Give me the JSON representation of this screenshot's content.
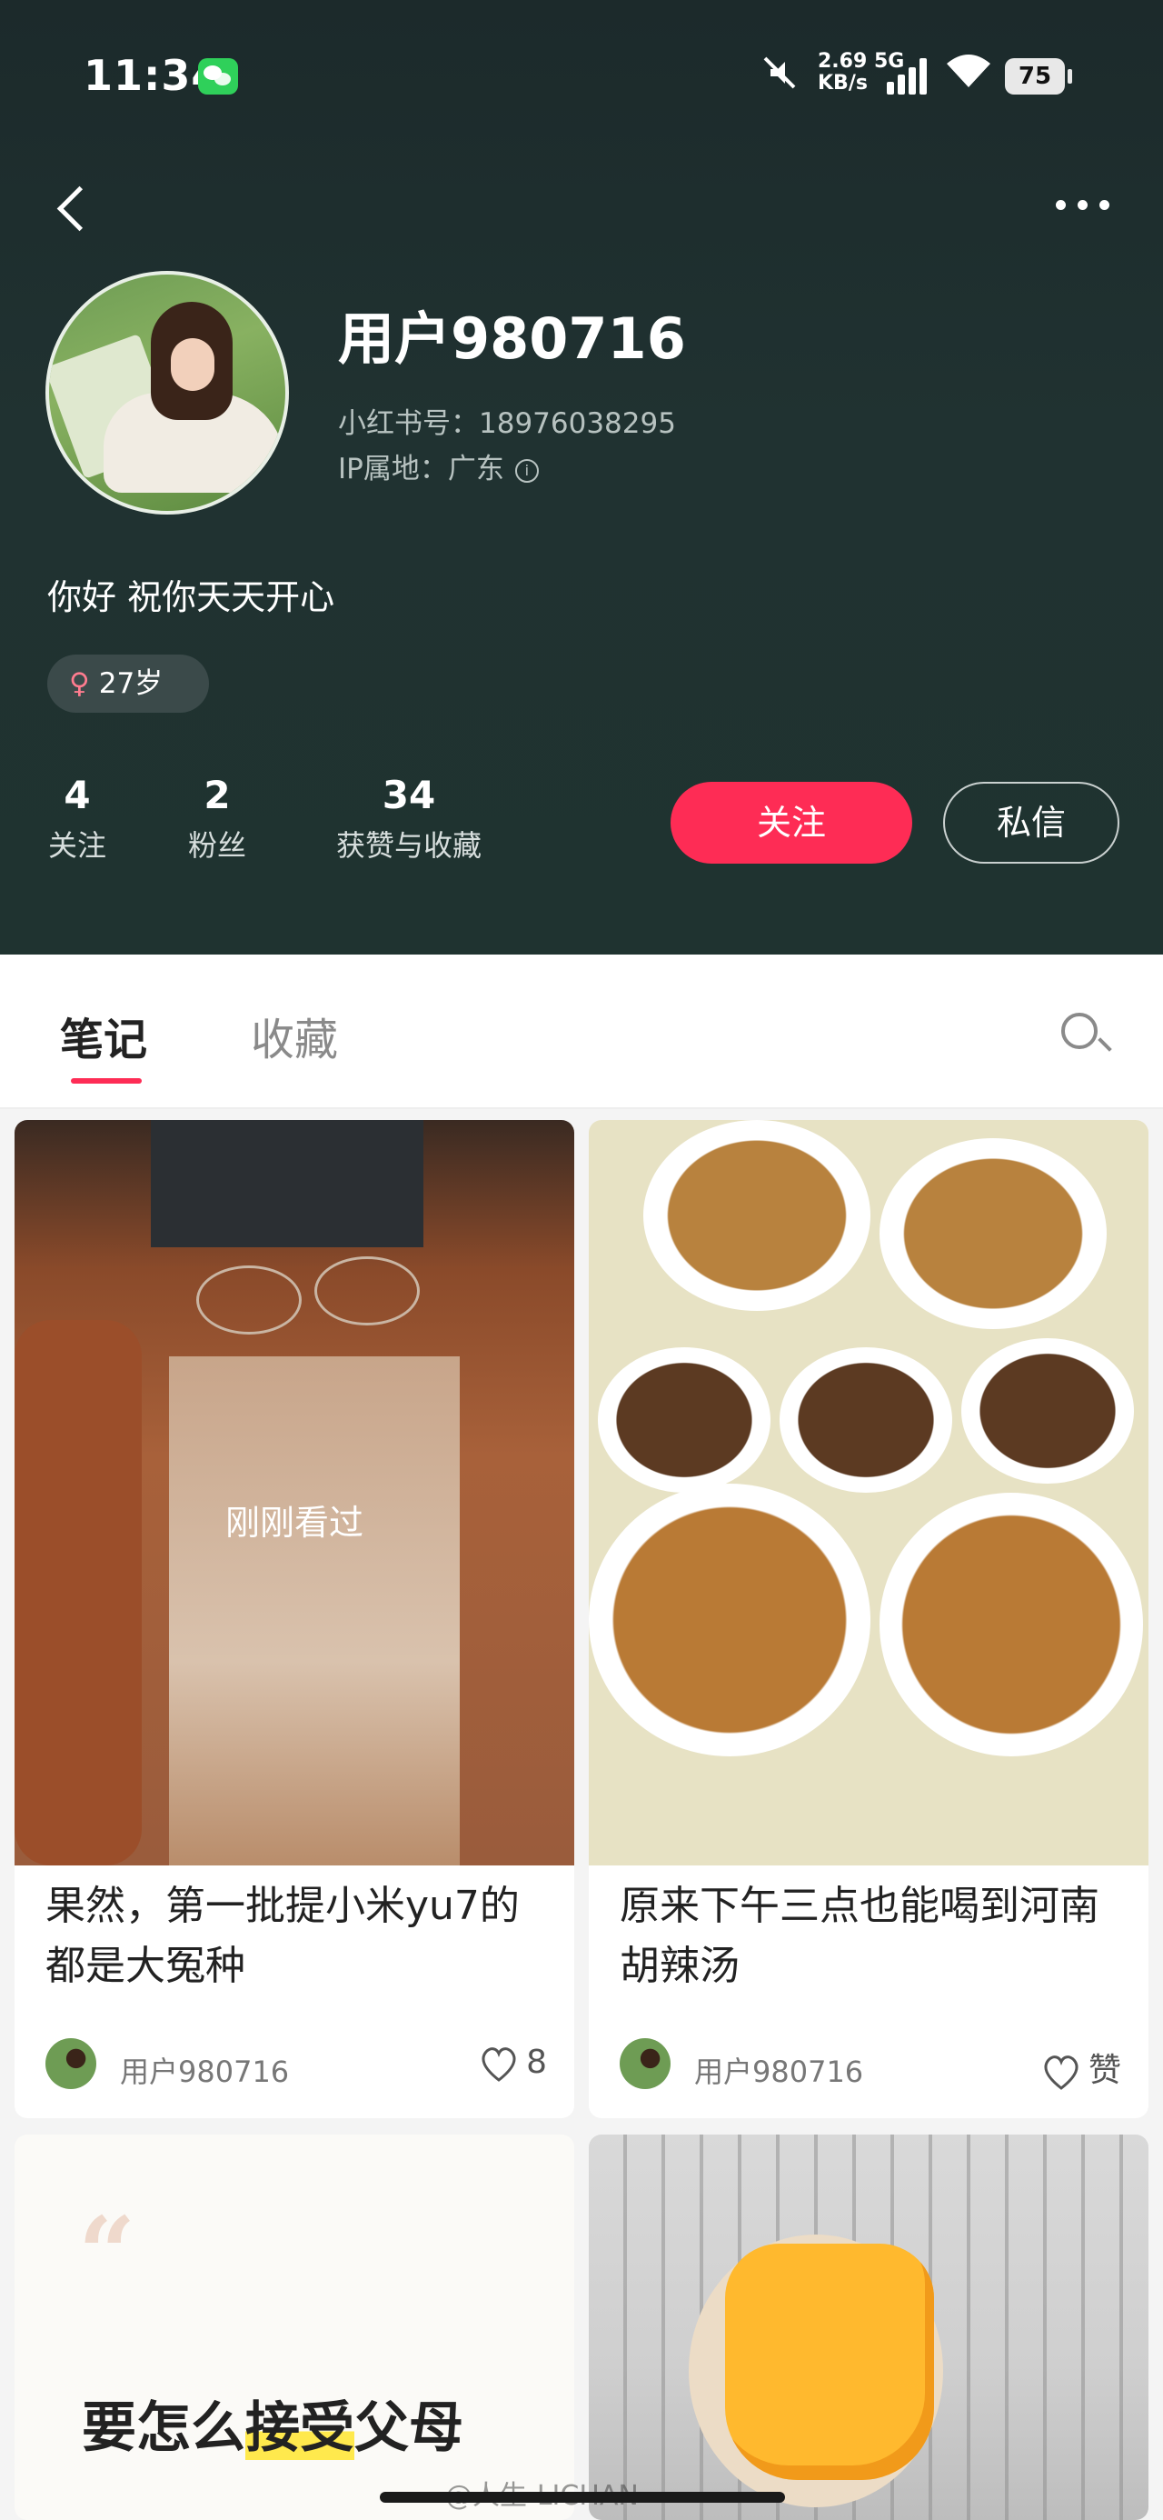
{
  "status_bar": {
    "time": "11:34",
    "network_speed_value": "2.69",
    "network_speed_unit": "KB/s",
    "network_type": "5G",
    "battery": "75",
    "icons": [
      "wechat-icon",
      "mute-icon",
      "signal-icon",
      "wifi-icon",
      "battery-icon"
    ]
  },
  "profile": {
    "username": "用户980716",
    "redbook_id": "小红书号：18976038295",
    "ip_location": "IP属地：广东",
    "bio": "你好 祝你天天开心",
    "gender_symbol": "♀",
    "age": "27岁"
  },
  "stats": [
    {
      "num": "4",
      "label": "关注"
    },
    {
      "num": "2",
      "label": "粉丝"
    },
    {
      "num": "34",
      "label": "获赞与收藏"
    }
  ],
  "actions": {
    "follow": "关注",
    "message": "私信"
  },
  "tabs": {
    "notes": "笔记",
    "favorites": "收藏"
  },
  "cards": [
    {
      "title": "果然，第一批提小米yu7的都是大冤种",
      "overlay": "刚刚看过",
      "author": "用户980716",
      "likes": "8"
    },
    {
      "title": "原来下午三点也能喝到河南胡辣汤",
      "author": "用户980716",
      "likes": "赞"
    },
    {
      "quote_mark": "“",
      "text_before": "要怎么",
      "text_highlight": "接受",
      "text_after": "父母"
    },
    {}
  ],
  "watermark": "@人生-LICHAN",
  "colors": {
    "accent": "#fe2c55",
    "header_bg": "#1f3130"
  }
}
